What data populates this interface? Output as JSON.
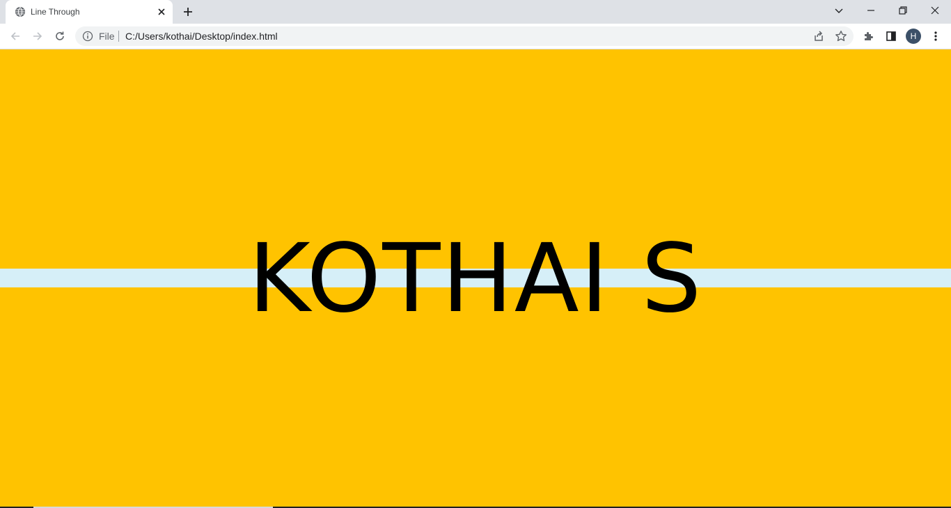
{
  "browser": {
    "tab": {
      "title": "Line Through",
      "favicon": "globe-icon"
    },
    "toolbar": {
      "scheme_label": "File",
      "url": "C:/Users/kothai/Desktop/index.html",
      "profile_initial": "H"
    }
  },
  "page": {
    "heading": "KOTHAI S",
    "background_color": "#ffc300",
    "stripe_color": "#d6eff8",
    "text_color": "#000000"
  }
}
